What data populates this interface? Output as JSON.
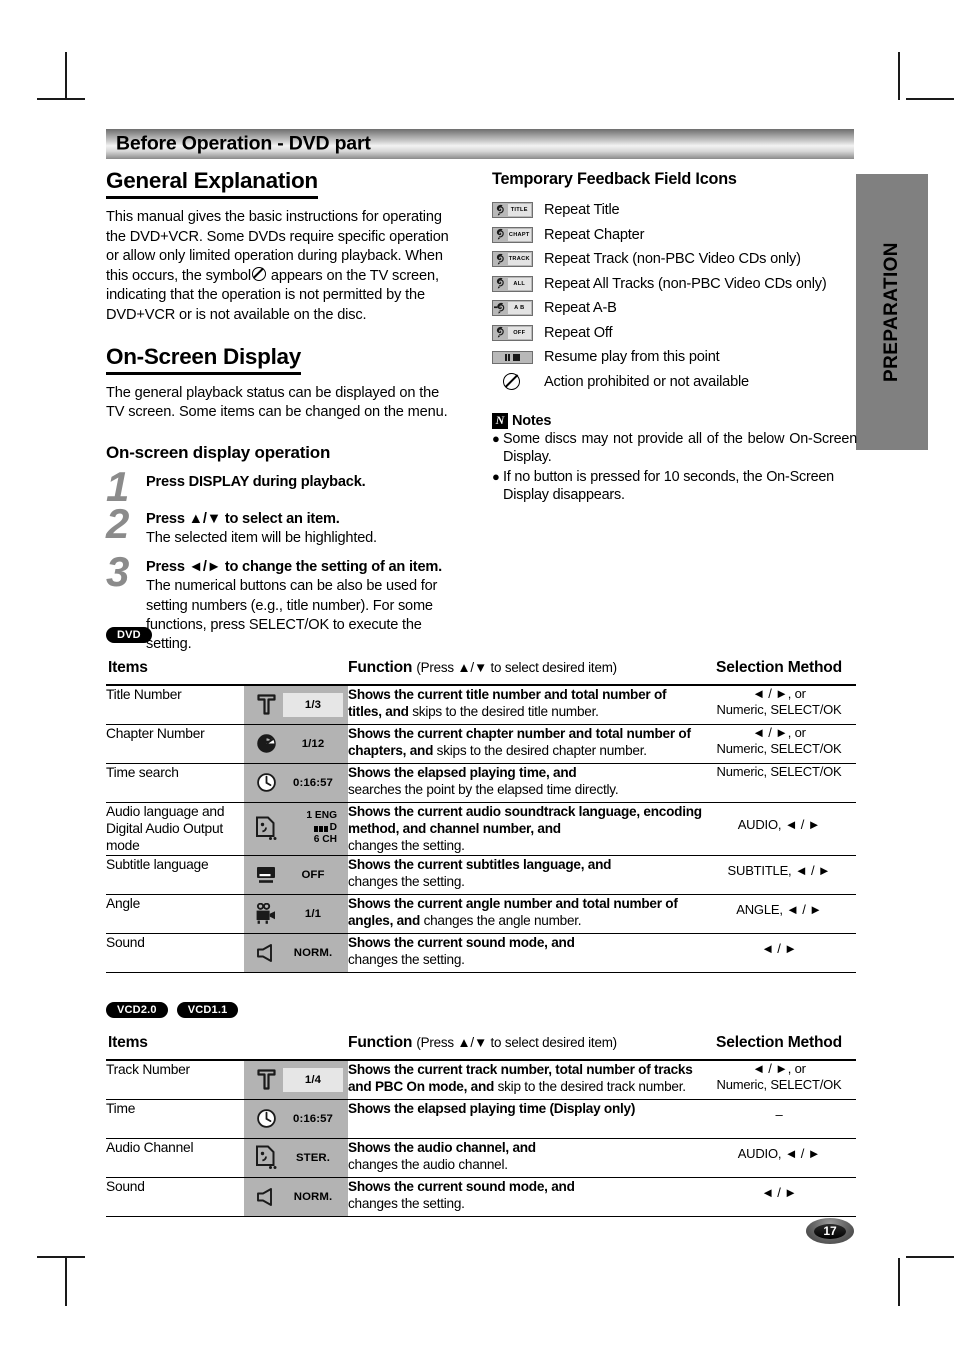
{
  "header": {
    "banner_title": "Before Operation - DVD part"
  },
  "side_tab": {
    "label": "PREPARATION"
  },
  "left": {
    "general_title": "General Explanation",
    "general_text_1": "This manual gives the basic instructions for operating the DVD+VCR. Some DVDs require specific operation or allow only limited operation during playback. When this occurs, the symbol",
    "general_text_2": "appears on the TV screen, indicating that the operation is not permitted by the DVD+VCR or is not available on the disc.",
    "osd_title": "On-Screen Display",
    "osd_text": "The general playback status can be displayed on the TV screen. Some items can be changed on the menu.",
    "osd_op_title": "On-screen display operation",
    "steps": [
      {
        "num": "1",
        "lead": "Press DISPLAY during playback.",
        "desc": ""
      },
      {
        "num": "2",
        "lead": "Press ▲/▼ to select an item.",
        "desc": "The selected item will be highlighted."
      },
      {
        "num": "3",
        "lead": "Press ◄/► to change the setting of an item.",
        "desc": "The numerical buttons can be also be used for setting numbers (e.g., title number). For some functions, press SELECT/OK to execute the setting."
      }
    ]
  },
  "right": {
    "tfi_title": "Temporary Feedback Field Icons",
    "icons": [
      {
        "chip": "TITLE",
        "label": "Repeat Title"
      },
      {
        "chip": "CHAPT",
        "label": "Repeat Chapter"
      },
      {
        "chip": "TRACK",
        "label": "Repeat Track (non-PBC Video CDs only)"
      },
      {
        "chip": "ALL",
        "label": "Repeat All Tracks (non-PBC Video CDs only)"
      },
      {
        "chip": "A  B",
        "label": "Repeat A-B"
      },
      {
        "chip": "OFF",
        "label": "Repeat Off"
      },
      {
        "chip": "",
        "label": "Resume play from this point"
      },
      {
        "chip": "",
        "label": "Action prohibited or not available"
      }
    ],
    "notes_title": "Notes",
    "notes_badge": "N",
    "notes": [
      "Some discs may not provide all of the below On-Screen Display.",
      "If no button is pressed for 10 seconds, the On-Screen Display disappears."
    ]
  },
  "dvd_table": {
    "badges": [
      "DVD"
    ],
    "headers": {
      "items": "Items",
      "function": "Function",
      "function_note": "(Press ▲/▼ to select desired item)",
      "selection": "Selection Method"
    },
    "rows": [
      {
        "item": "Title Number",
        "icon": "title-icon",
        "value": "1/3",
        "value_highlight": true,
        "func_bold": "Shows the current title number and total number of titles, and",
        "func_rest": " skips to the desired title number.",
        "sel_line1": "◄ / ►, or",
        "sel_line2": "Numeric, SELECT/OK"
      },
      {
        "item": "Chapter Number",
        "icon": "chapter-icon",
        "value": "1/12",
        "value_highlight": false,
        "func_bold": "Shows the current chapter number and total number of chapters, and",
        "func_rest": " skips to the desired chapter number.",
        "sel_line1": "◄ / ►, or",
        "sel_line2": "Numeric, SELECT/OK"
      },
      {
        "item": "Time search",
        "icon": "clock-icon",
        "value": "0:16:57",
        "value_highlight": false,
        "func_bold": "Shows the elapsed playing time, and",
        "func_rest": "searches the point by the elapsed time directly.",
        "sel_line1": "",
        "sel_line2": "Numeric, SELECT/OK"
      },
      {
        "item": "Audio language and Digital Audio Output mode",
        "icon": "audio-icon",
        "audio_line1": "1   ENG",
        "audio_line2": "D",
        "audio_line3": "6  CH",
        "func_bold": "Shows the current audio soundtrack language, encoding method, and channel number, and",
        "func_rest": "changes the setting.",
        "sel_line1": "",
        "sel_line2": "AUDIO,   ◄ / ►"
      },
      {
        "item": "Subtitle language",
        "icon": "subtitle-icon",
        "value": "OFF",
        "value_highlight": false,
        "func_bold": "Shows the current subtitles language, and",
        "func_rest": "changes the setting.",
        "sel_line1": "",
        "sel_line2": "SUBTITLE,   ◄ / ►"
      },
      {
        "item": "Angle",
        "icon": "camera-icon",
        "value": "1/1",
        "value_highlight": false,
        "func_bold": "Shows the current angle number and total number of angles, and",
        "func_rest": " changes the angle number.",
        "sel_line1": "",
        "sel_line2": "ANGLE,   ◄ / ►"
      },
      {
        "item": "Sound",
        "icon": "speaker-icon",
        "value": "NORM.",
        "value_highlight": false,
        "func_bold": "Shows the current sound mode, and",
        "func_rest": "changes the setting.",
        "sel_line1": "",
        "sel_line2": "◄ / ►"
      }
    ]
  },
  "vcd_table": {
    "badges": [
      "VCD2.0",
      "VCD1.1"
    ],
    "headers": {
      "items": "Items",
      "function": "Function",
      "function_note": "(Press ▲/▼ to select desired item)",
      "selection": "Selection Method"
    },
    "rows": [
      {
        "item": "Track Number",
        "icon": "title-icon",
        "value": "1/4",
        "value_highlight": true,
        "func_bold": "Shows the current track number, total number of tracks and PBC On mode, and",
        "func_rest": " skip to the desired track number.",
        "sel_line1": "◄ / ►, or",
        "sel_line2": "Numeric, SELECT/OK"
      },
      {
        "item": "Time",
        "icon": "clock-icon",
        "value": "0:16:57",
        "value_highlight": false,
        "func_bold": "Shows the elapsed playing time (Display only)",
        "func_rest": "",
        "sel_line1": "",
        "sel_line2": "–"
      },
      {
        "item": "Audio Channel",
        "icon": "audio-icon-simple",
        "value": "STER.",
        "value_highlight": false,
        "func_bold": "Shows the audio channel, and",
        "func_rest": "changes the audio channel.",
        "sel_line1": "",
        "sel_line2": "AUDIO, ◄ / ►"
      },
      {
        "item": "Sound",
        "icon": "speaker-icon",
        "value": "NORM.",
        "value_highlight": false,
        "func_bold": "Shows the current sound mode, and",
        "func_rest": "changes the setting.",
        "sel_line1": "",
        "sel_line2": "◄ / ►"
      }
    ]
  },
  "footer": {
    "page_number": "17"
  }
}
